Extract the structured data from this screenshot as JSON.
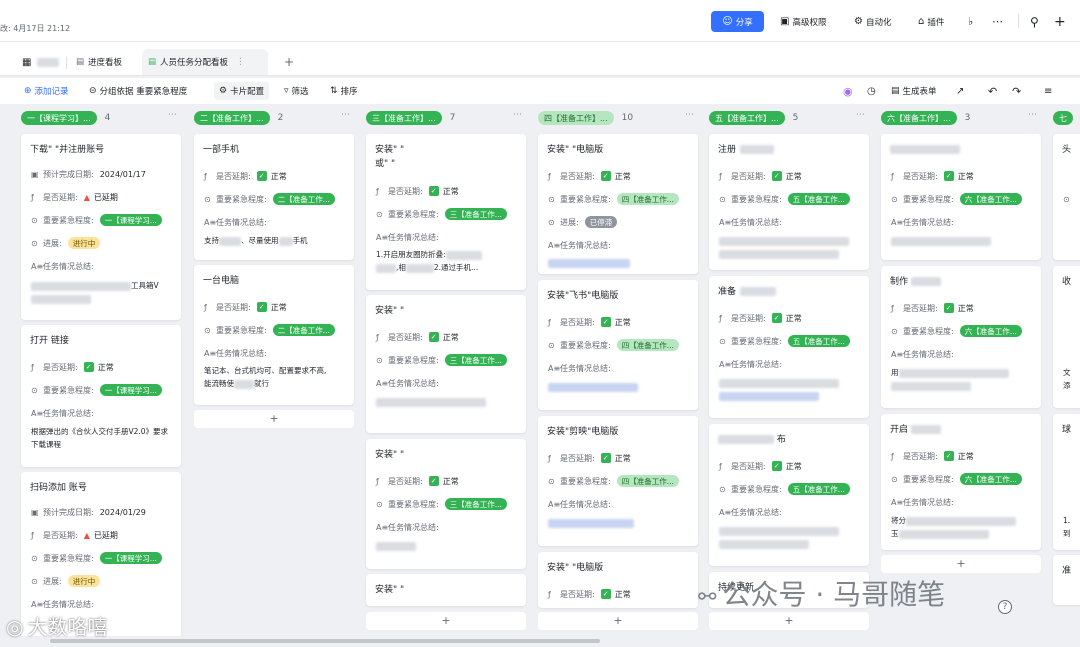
{
  "header": {
    "edit_time": "改: 4月17日 21:12",
    "share": "分享",
    "advanced_permissions": "高级权限",
    "automation": "自动化",
    "plugins": "插件"
  },
  "tabs": [
    {
      "label": "进度看板"
    },
    {
      "label": "人员任务分配看板"
    }
  ],
  "toolbar": {
    "add_record": "添加记录",
    "group_by": "分组依据 重要紧急程度",
    "card_config": "卡片配置",
    "filter": "筛选",
    "sort": "排序",
    "generate_form": "生成表单"
  },
  "labels": {
    "deadline": "预计完成日期:",
    "delayed": "是否延期:",
    "priority": "重要紧急程度:",
    "progress": "进展:",
    "summary": "任务情况总结:"
  },
  "values": {
    "normal": "正常",
    "overdue": "已延期",
    "in_progress": "进行中",
    "paused": "已停滞"
  },
  "columns": [
    {
      "tag": "一【课程学习】...",
      "count": "4",
      "cards": [
        {
          "title": "下载\"   \"并注册账号",
          "deadline": "2024/01/17",
          "delay": "已延期",
          "priority": "一【课程学习...",
          "progress": "进行中",
          "summary_tail": "工具箱V"
        },
        {
          "title": "打开    链接",
          "delay": "正常",
          "priority": "一【课程学习...",
          "summary": "根据弹出的《合伙人交付手册V2.0》要求下载课程"
        },
        {
          "title": "扫码添加        账号",
          "deadline": "2024/01/29",
          "delay": "已延期",
          "priority": "一【课程学习...",
          "progress": "进行中"
        }
      ]
    },
    {
      "tag": "二【准备工作】...",
      "count": "2",
      "cards": [
        {
          "title": "一部手机",
          "delay": "正常",
          "priority": "二【准备工作...",
          "summary_a": "支持",
          "summary_b": "尽量使用",
          "summary_c": "手机"
        },
        {
          "title": "一台电脑",
          "delay": "正常",
          "priority": "二【准备工作...",
          "summary_a": "笔记本、台式机均可、配置要求不高,",
          "summary_b": "能流畅使",
          "summary_c": "就行"
        }
      ]
    },
    {
      "tag": "三【准备工作】...",
      "count": "7",
      "cards": [
        {
          "title": "安装\"      \"",
          "title2": "或\"      \"",
          "delay": "正常",
          "priority": "三【准备工作...",
          "summary_a": "1.开启朋友圈防折叠:",
          "summary_b": "相",
          "summary_c": "2.通过手机..."
        },
        {
          "title": "安装\"        \"",
          "delay": "正常",
          "priority": "三【准备工作..."
        },
        {
          "title": "安装\"   \"",
          "delay": "正常",
          "priority": "三【准备工作..."
        },
        {
          "title": "安装\"      \""
        }
      ]
    },
    {
      "tag": "四【准备工作】...",
      "count": "10",
      "cards": [
        {
          "title": "安装\"     \"电脑版",
          "delay": "正常",
          "priority": "四【准备工作...",
          "progress": "已停滞"
        },
        {
          "title": "安装\"飞书\"电脑版",
          "delay": "正常",
          "priority": "四【准备工作..."
        },
        {
          "title": "安装\"剪映\"电脑版",
          "delay": "正常",
          "priority": "四【准备工作..."
        },
        {
          "title": "安装\"      \"电脑版",
          "delay": "正常"
        }
      ]
    },
    {
      "tag": "五【准备工作】...",
      "count": "5",
      "cards": [
        {
          "title": "注册",
          "delay": "正常",
          "priority": "五【准备工作..."
        },
        {
          "title": "准备",
          "delay": "正常",
          "priority": "五【准备工作..."
        },
        {
          "title": "        布",
          "delay": "正常",
          "priority": "五【准备工作..."
        },
        {
          "title": "    持续更新"
        }
      ]
    },
    {
      "tag": "六【准备工作】...",
      "count": "3",
      "cards": [
        {
          "title": "",
          "delay": "正常",
          "priority": "六【准备工作..."
        },
        {
          "title": "制作",
          "delay": "正常",
          "priority": "六【准备工作...",
          "summary": "用"
        },
        {
          "title": "开启",
          "delay": "正常",
          "priority": "六【准备工作...",
          "summary_a": "将分",
          "summary_b": "玉"
        }
      ]
    },
    {
      "tag": "七",
      "count": "",
      "cards": [
        {
          "title": "头"
        },
        {
          "title": "收",
          "summary_a": "文",
          "summary_b": "添"
        },
        {
          "title": "球",
          "summary_a": "1.",
          "summary_b": "到"
        },
        {
          "title": "准"
        }
      ]
    }
  ],
  "watermarks": {
    "wechat": "公众号 · 马哥随笔",
    "weibo": "大数咯嘻"
  },
  "add_glyph": "+"
}
